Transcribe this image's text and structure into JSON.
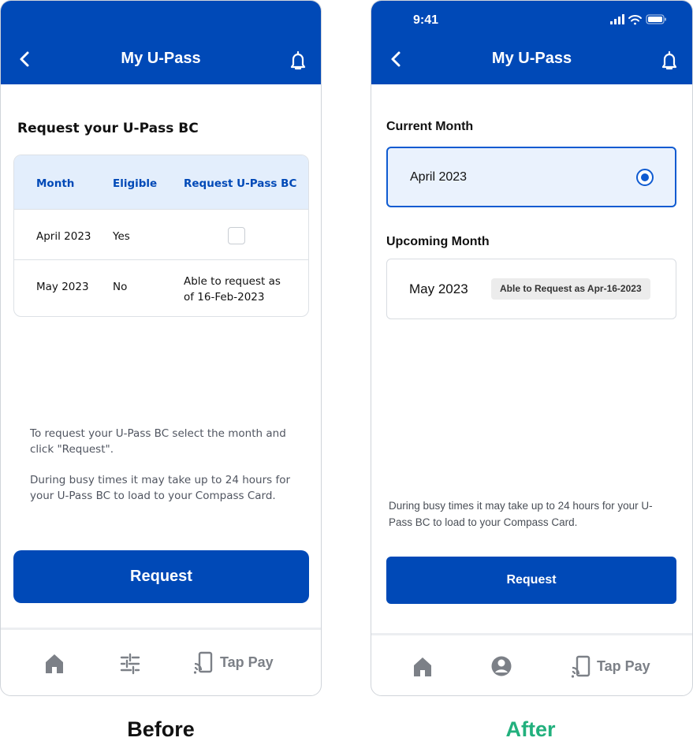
{
  "before": {
    "header": {
      "title": "My U-Pass"
    },
    "heading": "Request your U-Pass BC",
    "table": {
      "columns": [
        "Month",
        "Eligible",
        "Request U-Pass BC"
      ],
      "rows": [
        {
          "month": "April 2023",
          "eligible": "Yes",
          "request": ""
        },
        {
          "month": "May 2023",
          "eligible": "No",
          "request_line1": "Able to request as",
          "request_line2": "of 16-Feb-2023"
        }
      ]
    },
    "note1_line1": "To request your U-Pass BC select the month and",
    "note1_line2": "click \"Request\".",
    "note2_line1": "During busy times it may take up to 24 hours for",
    "note2_line2": "your U-Pass BC to load to your Compass Card.",
    "button": "Request",
    "tabbar": {
      "tap_pay": "Tap Pay"
    },
    "caption": "Before"
  },
  "after": {
    "status": {
      "time": "9:41"
    },
    "header": {
      "title": "My U-Pass"
    },
    "current_label": "Current Month",
    "current_month": "April 2023",
    "upcoming_label": "Upcoming Month",
    "upcoming_month": "May 2023",
    "upcoming_badge": "Able to Request as Apr-16-2023",
    "note_line1": "During busy times it may take up to 24 hours for your U-",
    "note_line2": "Pass BC to load to your Compass Card.",
    "button": "Request",
    "tabbar": {
      "tap_pay": "Tap Pay"
    },
    "caption": "After"
  },
  "colors": {
    "brand_blue": "#0049b7",
    "after_caption": "#22b07d"
  },
  "icons": [
    "back-chevron-icon",
    "bell-icon",
    "home-icon",
    "sliders-icon",
    "profile-icon",
    "tap-pay-icon",
    "signal-icon",
    "wifi-icon",
    "battery-icon"
  ]
}
